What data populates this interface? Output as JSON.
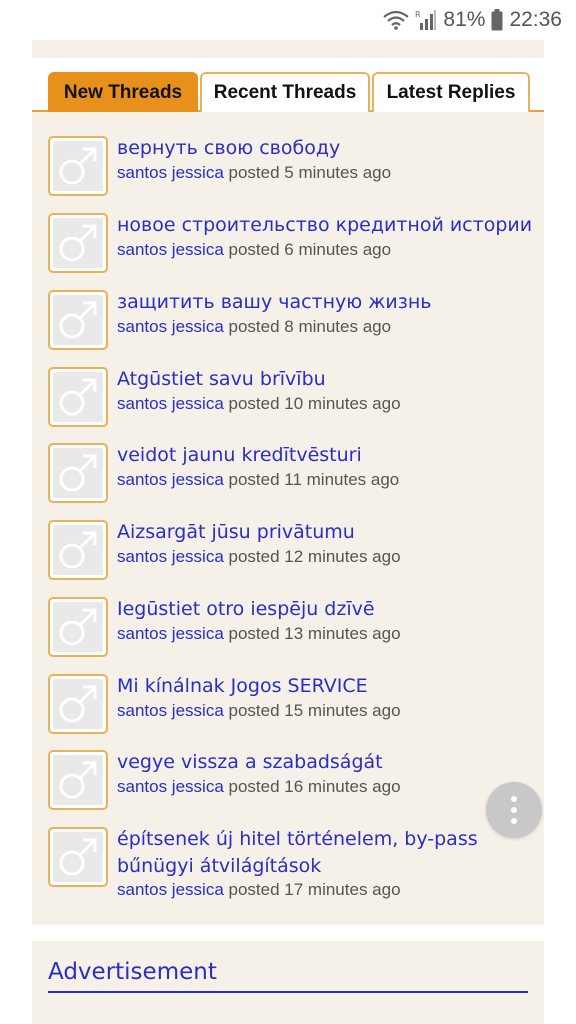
{
  "status_bar": {
    "battery": "81%",
    "time": "22:36",
    "icons": [
      "wifi-icon",
      "signal-icon",
      "battery-icon"
    ]
  },
  "tabs": [
    {
      "label": "New Threads",
      "active": true
    },
    {
      "label": "Recent Threads",
      "active": false
    },
    {
      "label": "Latest Replies",
      "active": false
    }
  ],
  "threads": [
    {
      "title": "вернуть свою свободу",
      "author": "santos jessica",
      "meta": "posted 5 minutes ago"
    },
    {
      "title": "новое строительство кредитной истории",
      "author": "santos jessica",
      "meta": "posted 6 minutes ago"
    },
    {
      "title": "защитить вашу частную жизнь",
      "author": "santos jessica",
      "meta": "posted 8 minutes ago"
    },
    {
      "title": "Atgūstiet savu brīvību",
      "author": "santos jessica",
      "meta": "posted 10 minutes ago"
    },
    {
      "title": "veidot jaunu kredītvēsturi",
      "author": "santos jessica",
      "meta": "posted 11 minutes ago"
    },
    {
      "title": "Aizsargāt jūsu privātumu",
      "author": "santos jessica",
      "meta": "posted 12 minutes ago"
    },
    {
      "title": "Iegūstiet otro iespēju dzīvē",
      "author": "santos jessica",
      "meta": "posted 13 minutes ago"
    },
    {
      "title": "Mi kínálnak Jogos SERVICE",
      "author": "santos jessica",
      "meta": "posted 15 minutes ago"
    },
    {
      "title": "vegye vissza a szabadságát",
      "author": "santos jessica",
      "meta": "posted 16 minutes ago"
    },
    {
      "title": "építsenek új hitel történelem, by-pass bűnügyi átvilágítások",
      "author": "santos jessica",
      "meta": "posted 17 minutes ago"
    }
  ],
  "advertisement": {
    "title": "Advertisement"
  },
  "colors": {
    "accent": "#e8901c",
    "link": "#2a2ec4",
    "panel_bg": "#f5f0e8",
    "avatar_border": "#e8b25a"
  }
}
